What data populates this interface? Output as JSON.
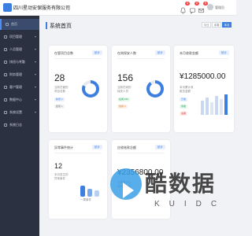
{
  "header": {
    "app_title": "四川星动安保服务有限公司",
    "notifications": [
      {
        "icon": "bell-icon",
        "count": "3"
      },
      {
        "icon": "message-icon",
        "count": "6"
      },
      {
        "icon": "mail-icon",
        "count": "5"
      }
    ],
    "user_name": "管理员"
  },
  "sidebar": {
    "items": [
      {
        "icon": "home-icon",
        "label": "首页",
        "active": true,
        "arrow": ""
      },
      {
        "icon": "building-icon",
        "label": "项目管理",
        "active": false,
        "arrow": "▾"
      },
      {
        "icon": "people-icon",
        "label": "人员管理",
        "active": false,
        "arrow": "▾"
      },
      {
        "icon": "task-icon",
        "label": "排班与考勤",
        "active": false,
        "arrow": "▾"
      },
      {
        "icon": "finance-icon",
        "label": "财务管理",
        "active": false,
        "arrow": "▾"
      },
      {
        "icon": "client-icon",
        "label": "客户管理",
        "active": false,
        "arrow": "▾"
      },
      {
        "icon": "report-icon",
        "label": "数据中心",
        "active": false,
        "arrow": "▾"
      },
      {
        "icon": "settings-icon",
        "label": "系统设置",
        "active": false,
        "arrow": "▾"
      },
      {
        "icon": "log-icon",
        "label": "系统日志",
        "active": false,
        "arrow": ""
      }
    ]
  },
  "page": {
    "title": "系统首页",
    "range_options": [
      "今日",
      "本周",
      "本月"
    ],
    "range_selected": "本月"
  },
  "cards": [
    {
      "title": "在管项目总数",
      "tag": "统计",
      "value": "28",
      "sub1": "当前在管的",
      "sub2": "项目总数",
      "pill1": "新增 2",
      "pill2": "结项 1",
      "ring_percent": 82,
      "ring_color": "#3d7fe0"
    },
    {
      "title": "在岗保安人数",
      "tag": "统计",
      "value": "156",
      "sub1": "当前在岗的",
      "sub2": "保安人员",
      "pill1": "在岗 156",
      "pill2": "缺岗 4",
      "ring_percent": 90,
      "ring_color": "#3d7fe0"
    },
    {
      "title": "本月收款金额",
      "tag": "统计",
      "value": "¥1285000.00",
      "sub1": "本月累计收",
      "sub2": "款总金额",
      "pill1": "已收",
      "pill2": "待收",
      "pill3": "逾期"
    },
    {
      "title": "异常事件统计",
      "tag": "统计",
      "value": "12",
      "sub1": "本月发生的",
      "sub2": "异常事件",
      "bar_caption": "一周事件"
    },
    {
      "title": "应收账款总额",
      "tag": "统计",
      "value": "¥2356800.00",
      "sub1": "当前累计应",
      "sub2": "收账款总额"
    }
  ],
  "watermark": {
    "cn": "酷数据",
    "en": "KUIDC"
  }
}
